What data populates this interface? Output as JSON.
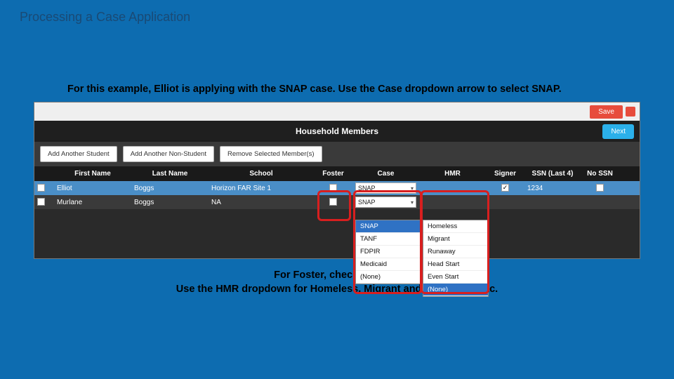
{
  "slide": {
    "title": "Processing a Case Application"
  },
  "instructions": {
    "top": "For this example, Elliot is applying with the SNAP case. Use the Case dropdown arrow to select SNAP.",
    "bottom_l1": "For Foster, check the box.",
    "bottom_l2": "Use the HMR dropdown for Homeless, Migrant and Runaways, etc."
  },
  "app": {
    "save": "Save",
    "section_title": "Household Members",
    "next": "Next",
    "buttons": {
      "add_student": "Add Another Student",
      "add_nonstudent": "Add Another Non-Student",
      "remove": "Remove Selected Member(s)"
    },
    "columns": {
      "first": "First Name",
      "last": "Last Name",
      "school": "School",
      "foster": "Foster",
      "case": "Case",
      "hmr": "HMR",
      "signer": "Signer",
      "ssn": "SSN (Last 4)",
      "nossn": "No SSN"
    },
    "rows": [
      {
        "first": "Elliot",
        "last": "Boggs",
        "school": "Horizon FAR Site 1",
        "case": "SNAP",
        "signer": true,
        "ssn": "1234"
      },
      {
        "first": "Murlane",
        "last": "Boggs",
        "school": "NA",
        "case": "SNAP"
      }
    ],
    "case_menu": [
      "SNAP",
      "TANF",
      "FDPIR",
      "Medicaid",
      "(None)"
    ],
    "hmr_menu": [
      "Homeless",
      "Migrant",
      "Runaway",
      "Head Start",
      "Even Start",
      "(None)"
    ]
  }
}
